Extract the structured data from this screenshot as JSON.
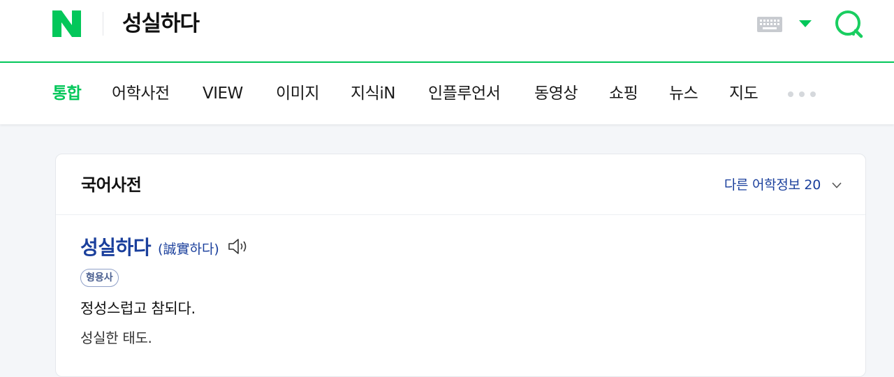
{
  "header": {
    "logo": "N",
    "query": "성실하다",
    "keyboard_icon": "keyboard-icon",
    "dropdown_icon": "caret-down-icon",
    "search_icon": "search-icon",
    "accent_color": "#03c75a"
  },
  "tabs": [
    {
      "label": "통합",
      "active": true
    },
    {
      "label": "어학사전"
    },
    {
      "label": "VIEW"
    },
    {
      "label": "이미지"
    },
    {
      "label": "지식iN"
    },
    {
      "label": "인플루언서"
    },
    {
      "label": "동영상"
    },
    {
      "label": "쇼핑"
    },
    {
      "label": "뉴스"
    },
    {
      "label": "지도"
    }
  ],
  "dictionary": {
    "title": "국어사전",
    "more_languages": "다른 어학정보 20",
    "entry": {
      "word": "성실하다",
      "hanja": "(誠實하다)",
      "pos": "형용사",
      "definition": "정성스럽고 참되다.",
      "example": "성실한 태도."
    },
    "link_color": "#1a3f9c"
  }
}
